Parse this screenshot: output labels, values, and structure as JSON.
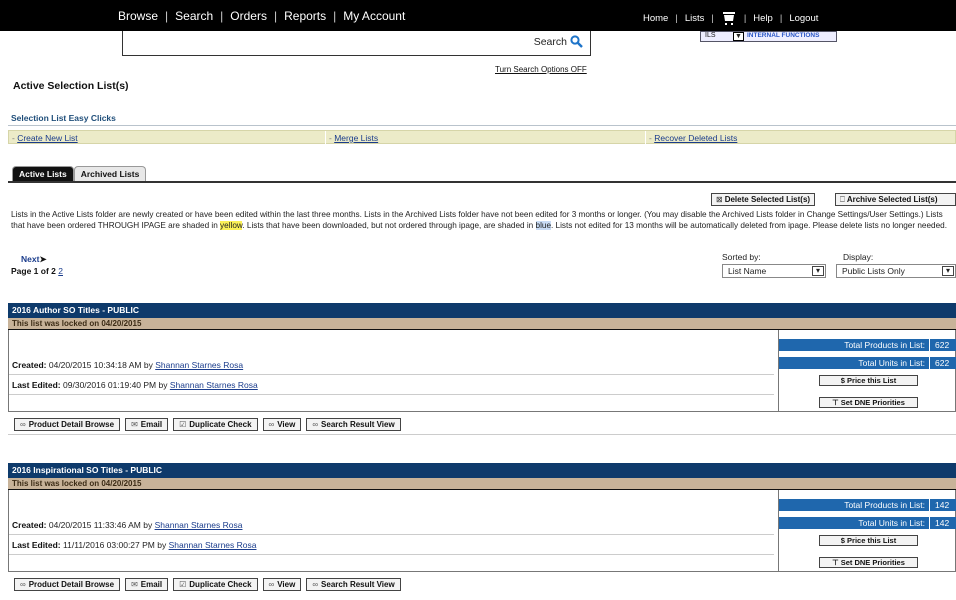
{
  "topnav": {
    "left_items": [
      "Browse",
      "Search",
      "Orders",
      "Reports",
      "My Account"
    ],
    "right_items": [
      "Home",
      "Lists"
    ],
    "right_items_after_cart": [
      "Help",
      "Logout"
    ],
    "cart_icon": "shopping-cart-icon"
  },
  "search": {
    "button_label": "Search",
    "icon": "magnifier-icon",
    "mini_select_value": "ILS",
    "internal_functions": "INTERNAL FUNCTIONS",
    "turn_off_link": "Turn Search Options OFF"
  },
  "page_title": "Active Selection List(s)",
  "easy_clicks": {
    "title": "Selection List Easy Clicks",
    "links": [
      "Create New List",
      "Merge Lists",
      "Recover Deleted Lists"
    ],
    "prefix": "- "
  },
  "tabs": [
    "Active Lists",
    "Archived Lists"
  ],
  "actions": {
    "delete_label": "Delete Selected List(s)",
    "archive_label": "Archive Selected List(s)"
  },
  "description": {
    "part1": "Lists in the Active Lists folder are newly created or have been edited within the last three months. Lists in the Archived Lists folder have not been edited for 3 months or longer. (You may disable the Archived Lists folder in Change Settings/User Settings.) Lists that have been ordered THROUGH IPAGE are shaded in ",
    "yellow": "yellow",
    "part2": ". Lists that have been downloaded, but not ordered through ipage, are shaded in ",
    "blue": "blue",
    "part3": ". Lists not edited for 13 months will be automatically deleted from ipage. Please delete lists no longer needed."
  },
  "pagination": {
    "next": "Next",
    "page_text": "Page 1 of 2",
    "page_link": "2"
  },
  "sorting": {
    "sorted_label": "Sorted by:",
    "sorted_value": "List Name",
    "display_label": "Display:",
    "display_value": "Public Lists Only"
  },
  "lists": [
    {
      "title": "2016 Author SO Titles - PUBLIC",
      "locked": "This list was locked on 04/20/2015",
      "created_label": "Created:",
      "created": "04/20/2015 10:34:18 AM by",
      "created_by": "Shannan Starnes Rosa",
      "edited_label": "Last Edited:",
      "edited": "09/30/2016 01:19:40 PM by",
      "edited_by": "Shannan Starnes Rosa",
      "total_products_label": "Total Products in List:",
      "total_products": "622",
      "total_units_label": "Total Units in List:",
      "total_units": "622",
      "price_button": "$ Price this List",
      "dne_button": "⊤ Set DNE Priorities",
      "footer": [
        "Product Detail Browse",
        "Email",
        "Duplicate Check",
        "View",
        "Search Result View"
      ]
    },
    {
      "title": "2016 Inspirational SO Titles - PUBLIC",
      "locked": "This list was locked on 04/20/2015",
      "created_label": "Created:",
      "created": "04/20/2015 11:33:46 AM by",
      "created_by": "Shannan Starnes Rosa",
      "edited_label": "Last Edited:",
      "edited": "11/11/2016 03:00:27 PM by",
      "edited_by": "Shannan Starnes Rosa",
      "total_products_label": "Total Products in List:",
      "total_products": "142",
      "total_units_label": "Total Units in List:",
      "total_units": "142",
      "price_button": "$ Price this List",
      "dne_button": "⊤ Set DNE Priorities",
      "footer": [
        "Product Detail Browse",
        "Email",
        "Duplicate Check",
        "View",
        "Search Result View"
      ]
    }
  ],
  "colors": {
    "header_navy": "#0e3a6b",
    "lock_tan": "#c8b399",
    "stat_blue": "#1f67ad",
    "easy_row": "#ecebc8"
  }
}
